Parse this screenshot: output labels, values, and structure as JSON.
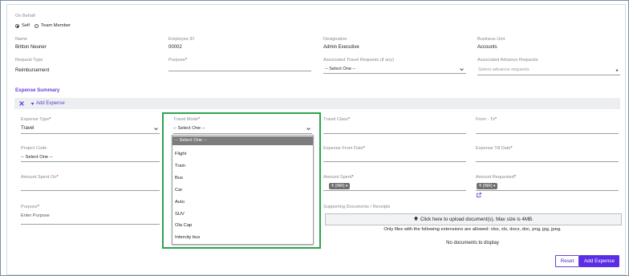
{
  "on_behalf": {
    "label": "On Behalf",
    "options": [
      "Self",
      "Team Member"
    ]
  },
  "fields_row1": {
    "name_label": "Name",
    "name_value": "Britton Neuner",
    "empid_label": "Employee ID",
    "empid_value": "00002",
    "designation_label": "Designation",
    "designation_value": "Admin Executive",
    "bu_label": "Business Unit",
    "bu_value": "Accounts"
  },
  "fields_row2": {
    "request_type_label": "Request Type",
    "request_type_value": "Reimbursement",
    "purpose_label": "Purpose",
    "assoc_travel_label": "Associated Travel Requests (if any)",
    "assoc_travel_value": "-- Select One --",
    "assoc_advance_label": "Associated Advance Requests",
    "assoc_advance_placeholder": "Select advance requests"
  },
  "expense_summary": {
    "title": "Expense Summary",
    "add_expense_label": "Add Expense"
  },
  "expense_form": {
    "expense_type_label": "Expense Type",
    "expense_type_value": "Travel",
    "travel_mode_label": "Travel Mode",
    "travel_mode_value": "-- Select One --",
    "travel_class_label": "Travel Class",
    "from_to_label": "From - To",
    "project_code_label": "Project Code",
    "project_code_value": "-- Select One --",
    "expense_from_date_label": "Expense From Date",
    "expense_till_date_label": "Expense Till Date",
    "amount_spent_on_label": "Amount Spent On",
    "amount_spent_label": "Amount Spent",
    "amount_spent_currency": "₹ (INR)",
    "amount_requested_label": "Amount Requested",
    "amount_requested_currency": "₹ (INR)",
    "purpose_label": "Purpose",
    "purpose_placeholder": "Enter Purpose",
    "supporting_docs_label": "Supporting Documents / Receipts",
    "upload_label": "Click here to upload document(s). Max size is 4MB.",
    "allowed_ext_note": "Only files with the following extensions are allowed: xlsx, xls, docx, doc, png, jpg, jpeg.",
    "no_docs": "No documents to display"
  },
  "travel_mode_options": [
    "-- Select One --",
    "Flight",
    "Train",
    "Bus",
    "Car",
    "Auto",
    "SUV",
    "Ola Cap",
    "Intercity bus"
  ],
  "buttons": {
    "reset": "Reset",
    "add_expense": "Add Expense"
  },
  "colors": {
    "accent": "#6b3fd6",
    "required": "#d0112b",
    "highlight": "#2da44e",
    "primary_button": "#5b2ee6"
  }
}
